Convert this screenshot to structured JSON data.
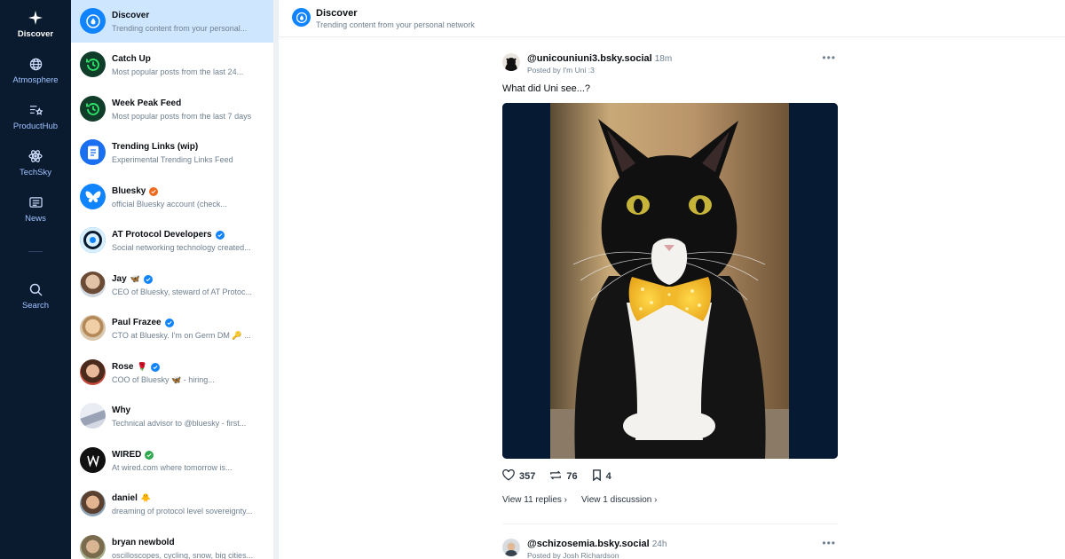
{
  "rail": {
    "items": [
      {
        "label": "Discover"
      },
      {
        "label": "Atmosphere"
      },
      {
        "label": "ProductHub"
      },
      {
        "label": "TechSky"
      },
      {
        "label": "News"
      },
      {
        "label": "Search"
      }
    ]
  },
  "feeds": {
    "items": [
      {
        "title": "Discover",
        "subtitle": "Trending content from your personal..."
      },
      {
        "title": "Catch Up",
        "subtitle": "Most popular posts from the last 24..."
      },
      {
        "title": "Week Peak Feed",
        "subtitle": "Most popular posts from the last 7 days"
      },
      {
        "title": "Trending Links (wip)",
        "subtitle": "Experimental Trending Links Feed"
      },
      {
        "title": "Bluesky",
        "subtitle": "official Bluesky account (check..."
      },
      {
        "title": "AT Protocol Developers",
        "subtitle": "Social networking technology created..."
      },
      {
        "title": "Jay",
        "emoji": "🦋",
        "subtitle": "CEO of Bluesky, steward of AT Protoc..."
      },
      {
        "title": "Paul Frazee",
        "subtitle": "CTO at Bluesky. I'm on Germ DM 🔑 ..."
      },
      {
        "title": "Rose",
        "emoji": "🌹",
        "subtitle": "COO of Bluesky 🦋 - hiring..."
      },
      {
        "title": "Why",
        "subtitle": "Technical advisor to @bluesky - first..."
      },
      {
        "title": "WIRED",
        "subtitle": "At wired.com where tomorrow is..."
      },
      {
        "title": "daniel",
        "emoji": "🐥",
        "subtitle": "dreaming of protocol level sovereignty..."
      },
      {
        "title": "bryan newbold",
        "subtitle": "oscilloscopes, cycling, snow, big cities..."
      }
    ]
  },
  "header": {
    "title": "Discover",
    "subtitle": "Trending content from your personal network"
  },
  "posts": [
    {
      "handle": "@unicouniuni3.bsky.social",
      "time": "18m",
      "reposted_by": "Posted by I'm Uni :3",
      "text": "What did Uni see...?",
      "likes": "357",
      "reposts": "76",
      "bookmarks": "4",
      "replies_link": "View 11 replies",
      "discussion_link": "View 1 discussion"
    },
    {
      "handle": "@schizosemia.bsky.social",
      "time": "24h",
      "reposted_by": "Posted by Josh Richardson"
    }
  ],
  "colors": {
    "rail_bg": "#0a1a2f",
    "accent": "#1083fe",
    "active_feed_bg": "#cfe7fe",
    "verified": "#1083fe",
    "verified_orange": "#f06a1d",
    "verified_green": "#2fa84f"
  }
}
